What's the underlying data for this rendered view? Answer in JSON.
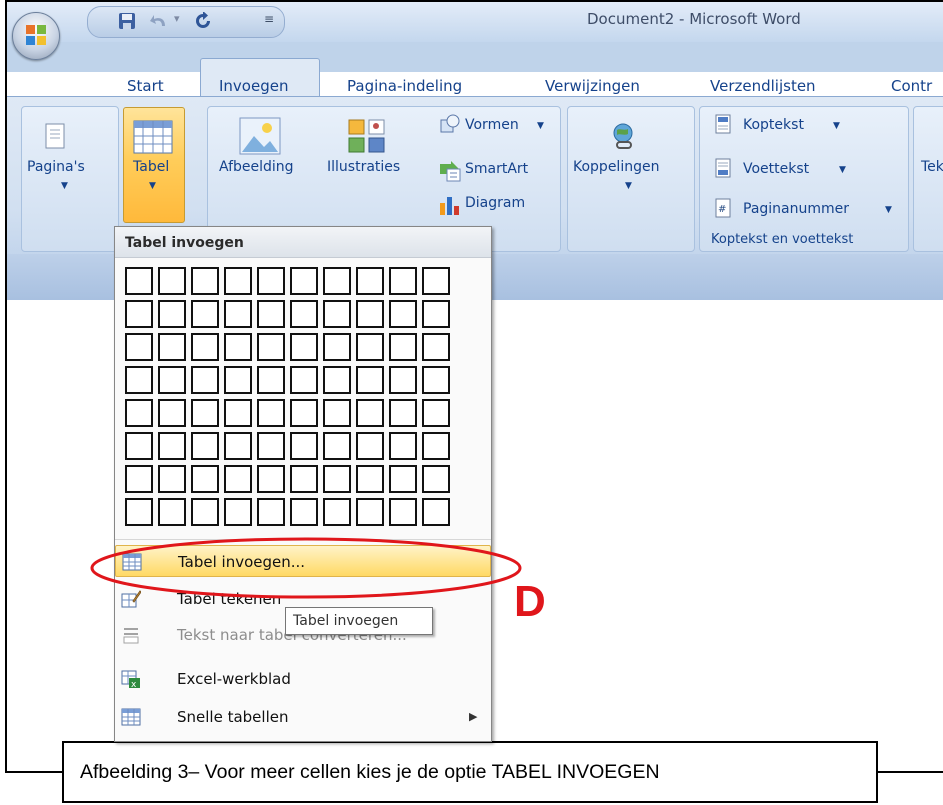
{
  "window": {
    "title": "Document2 - Microsoft Word"
  },
  "tabs": [
    "Start",
    "Invoegen",
    "Pagina-indeling",
    "Verwijzingen",
    "Verzendlijsten",
    "Contr"
  ],
  "active_tab": "Invoegen",
  "ribbon": {
    "paginas": "Pagina's",
    "tabel": "Tabel",
    "afbeelding": "Afbeelding",
    "illustraties": "Illustraties",
    "vormen": "Vormen",
    "smartart": "SmartArt",
    "diagram": "Diagram",
    "koppelingen": "Koppelingen",
    "koptekst": "Koptekst",
    "voettekst": "Voettekst",
    "paginanummer": "Paginanummer",
    "group_header_footer": "Koptekst en voettekst",
    "tekst_partial": "Tek"
  },
  "menu": {
    "title": "Tabel invoegen",
    "grid": {
      "columns": 10,
      "rows": 8
    },
    "items": [
      {
        "label": "Tabel invoegen...",
        "highlighted": true,
        "disabled": false
      },
      {
        "label": "Tabel tekenen",
        "highlighted": false,
        "disabled": false
      },
      {
        "label": "Tekst naar tabel converteren...",
        "highlighted": false,
        "disabled": true
      },
      {
        "label": "Excel-werkblad",
        "highlighted": false,
        "disabled": false
      },
      {
        "label": "Snelle tabellen",
        "highlighted": false,
        "disabled": false,
        "submenu": true
      }
    ]
  },
  "tooltip": "Tabel invoegen",
  "annotation_letter": "D",
  "caption": "Afbeelding 3– Voor meer cellen kies je de optie TABEL INVOEGEN",
  "colors": {
    "ribbon_blue": "#15428b",
    "highlight": "#ffcd5a",
    "annotation_red": "#e0161b"
  }
}
